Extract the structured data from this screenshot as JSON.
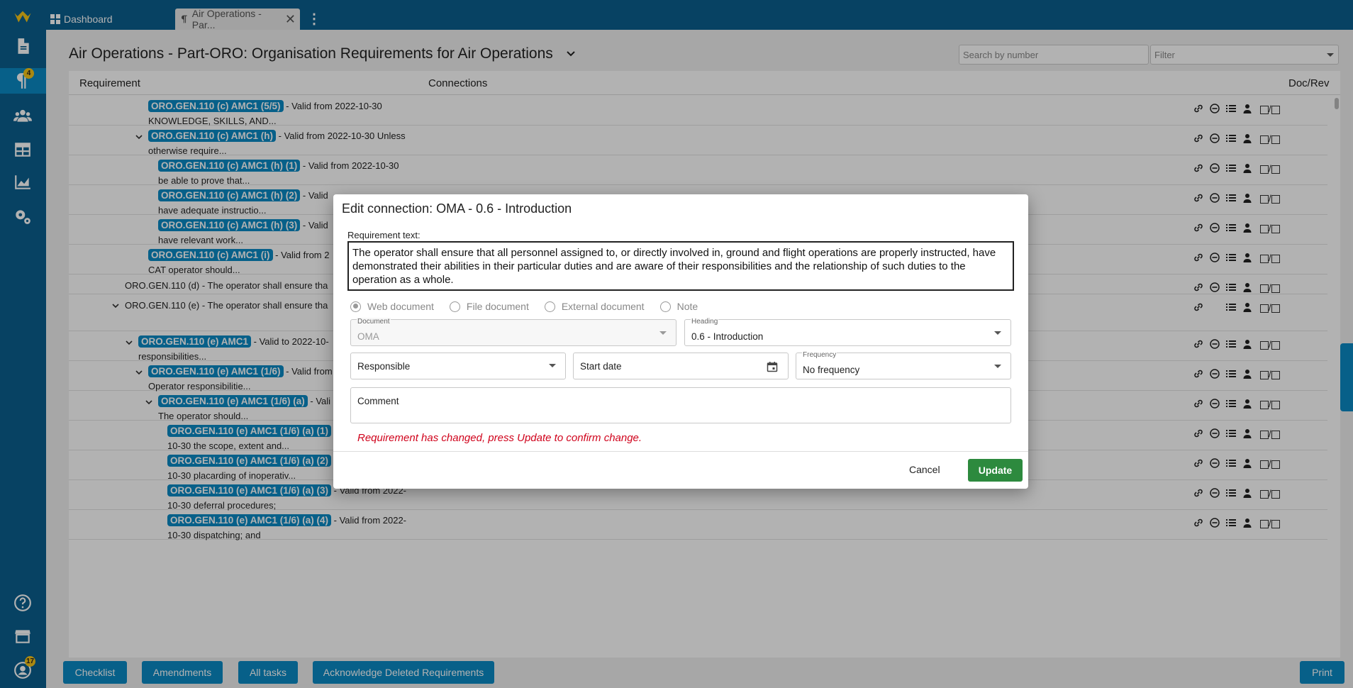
{
  "sidebar": {
    "notifications_badge": "4",
    "user_badge": "17"
  },
  "tabs": [
    {
      "label": "Dashboard"
    },
    {
      "label": "Air Operations - Par..."
    }
  ],
  "page": {
    "title": "Air Operations - Part-ORO: Organisation Requirements for Air Operations",
    "search_placeholder": "Search by number",
    "filter_placeholder": "Filter"
  },
  "table": {
    "columns": [
      "Requirement",
      "Connections",
      "Doc/Rev"
    ],
    "docrev_sep": "/",
    "rows": [
      {
        "tag": "ORO.GEN.110 (c) AMC1 (5/5)",
        "text1": " - Valid from 2022-10-30",
        "text2": "KNOWLEDGE, SKILLS, AND..."
      },
      {
        "tag": "ORO.GEN.110 (c) AMC1 (h)",
        "text1": " - Valid from 2022-10-30 Unless",
        "text2": "otherwise require..."
      },
      {
        "tag": "ORO.GEN.110 (c) AMC1 (h) (1)",
        "text1": " - Valid from 2022-10-30",
        "text2": "be able to prove that..."
      },
      {
        "tag": "ORO.GEN.110 (c) AMC1 (h) (2)",
        "text1": " - Valid",
        "text2": "have adequate instructio..."
      },
      {
        "tag": "ORO.GEN.110 (c) AMC1 (h) (3)",
        "text1": " - Valid",
        "text2": "have relevant work..."
      },
      {
        "tag": "ORO.GEN.110 (c) AMC1 (i)",
        "text1": " - Valid from 2",
        "text2": "CAT operator should..."
      },
      {
        "tag": "",
        "text1": "ORO.GEN.110 (d) - The operator shall ensure tha",
        "text2": ""
      },
      {
        "tag": "",
        "text1": "ORO.GEN.110 (e) - The operator shall ensure tha",
        "text2": ""
      },
      {
        "tag": "ORO.GEN.110 (e) AMC1",
        "text1": " - Valid to 2022-10-",
        "text2": "responsibilities..."
      },
      {
        "tag": "ORO.GEN.110 (e) AMC1 (1/6)",
        "text1": " - Valid from",
        "text2": "Operator responsibilitie..."
      },
      {
        "tag": "ORO.GEN.110 (e) AMC1 (1/6) (a)",
        "text1": " - Vali",
        "text2": "The operator should..."
      },
      {
        "tag": "ORO.GEN.110 (e) AMC1 (1/6) (a) (1)",
        "text1": " - Valid from 2022-",
        "text2": "10-30 the scope, extent and..."
      },
      {
        "tag": "ORO.GEN.110 (e) AMC1 (1/6) (a) (2)",
        "text1": " - Valid from 2022-",
        "text2": "10-30 placarding of inoperativ..."
      },
      {
        "tag": "ORO.GEN.110 (e) AMC1 (1/6) (a) (3)",
        "text1": " - Valid from 2022-",
        "text2": "10-30 deferral procedures;"
      },
      {
        "tag": "ORO.GEN.110 (e) AMC1 (1/6) (a) (4)",
        "text1": " - Valid from 2022-",
        "text2": "10-30 dispatching; and"
      }
    ]
  },
  "bottom_buttons": [
    "Checklist",
    "Amendments",
    "All tasks",
    "Acknowledge Deleted Requirements",
    "Print"
  ],
  "modal": {
    "title": "Edit connection: OMA - 0.6 - Introduction",
    "req_label": "Requirement text:",
    "req_text": "The operator shall ensure that all personnel assigned to, or directly involved in, ground and flight operations are properly instructed, have demonstrated their abilities in their particular duties and are aware of their responsibilities and the relationship of such duties to the operation as a whole.",
    "radios": [
      {
        "label": "Web document",
        "checked": true
      },
      {
        "label": "File document",
        "checked": false
      },
      {
        "label": "External document",
        "checked": false
      },
      {
        "label": "Note",
        "checked": false
      }
    ],
    "document_label": "Document",
    "document_value": "OMA",
    "heading_label": "Heading",
    "heading_value": "0.6 - Introduction",
    "responsible_placeholder": "Responsible",
    "start_date_placeholder": "Start date",
    "frequency_label": "Frequency",
    "frequency_value": "No frequency",
    "comment_placeholder": "Comment",
    "warning": "Requirement has changed, press Update to confirm change.",
    "cancel_label": "Cancel",
    "update_label": "Update",
    "update_color": "#2d8a3e",
    "warning_color": "#d0021b"
  },
  "colors": {
    "brand": "#0b5f8f",
    "tag": "#0b8ac5"
  }
}
